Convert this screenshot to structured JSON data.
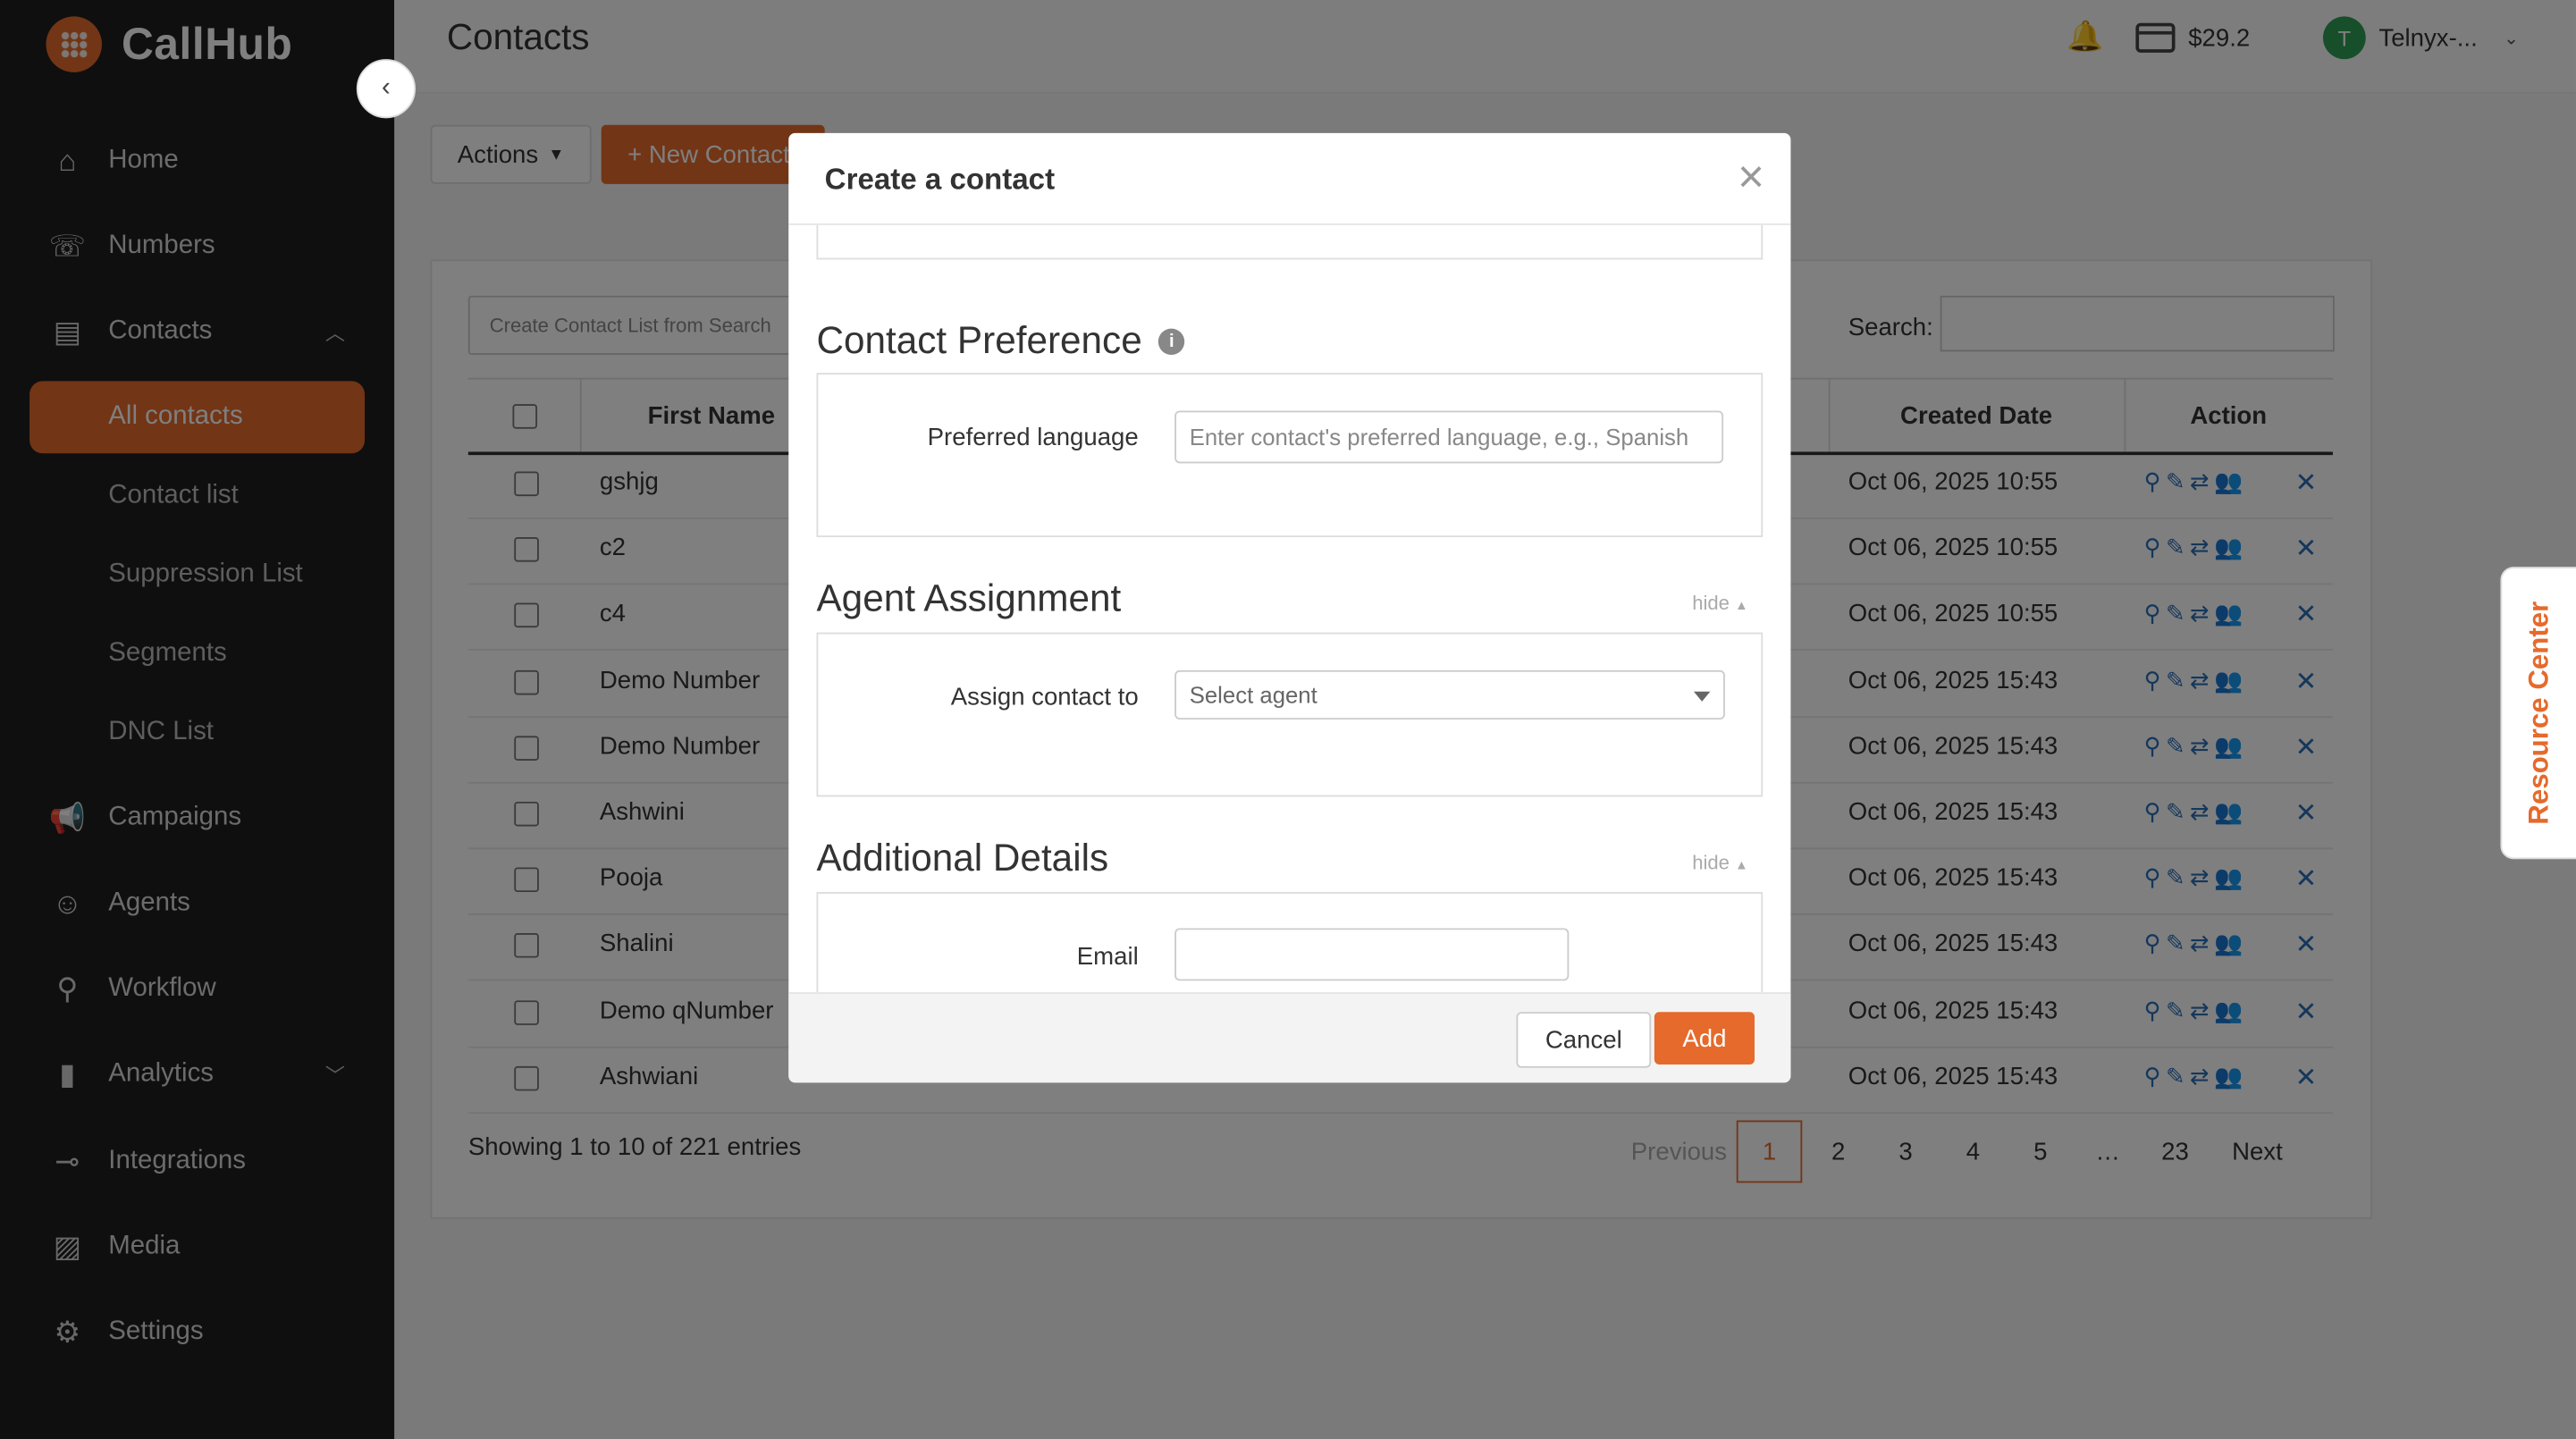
{
  "brand": {
    "name": "CallHub",
    "accent": "#e56a2c"
  },
  "sidebar": {
    "items": [
      {
        "label": "Home",
        "icon": "home-icon"
      },
      {
        "label": "Numbers",
        "icon": "phone-icon"
      },
      {
        "label": "Contacts",
        "icon": "contacts-book-icon"
      },
      {
        "label": "Campaigns",
        "icon": "megaphone-icon"
      },
      {
        "label": "Agents",
        "icon": "person-icon"
      },
      {
        "label": "Workflow",
        "icon": "workflow-icon"
      },
      {
        "label": "Analytics",
        "icon": "bar-chart-icon"
      },
      {
        "label": "Integrations",
        "icon": "plug-icon"
      },
      {
        "label": "Media",
        "icon": "image-icon"
      },
      {
        "label": "Settings",
        "icon": "gear-icon"
      }
    ],
    "contacts_sub": [
      "All contacts",
      "Contact list",
      "Suppression List",
      "Segments",
      "DNC List"
    ]
  },
  "header": {
    "title": "Contacts",
    "credit": "$29.2",
    "user_initial": "T",
    "user_name": "Telnyx-..."
  },
  "toolbar": {
    "actions_label": "Actions",
    "new_contact_label": "+ New Contact"
  },
  "table": {
    "list_placeholder": "Create Contact List from Search",
    "search_label": "Search:",
    "col_first_name": "First Name",
    "col_created_date": "Created Date",
    "col_action": "Action",
    "rows": [
      {
        "first_name": "gshjg",
        "created": "Oct 06, 2025 10:55"
      },
      {
        "first_name": "c2",
        "created": "Oct 06, 2025 10:55"
      },
      {
        "first_name": "c4",
        "created": "Oct 06, 2025 10:55"
      },
      {
        "first_name": "Demo Number",
        "created": "Oct 06, 2025 15:43"
      },
      {
        "first_name": "Demo Number",
        "created": "Oct 06, 2025 15:43"
      },
      {
        "first_name": "Ashwini",
        "created": "Oct 06, 2025 15:43"
      },
      {
        "first_name": "Pooja",
        "created": "Oct 06, 2025 15:43"
      },
      {
        "first_name": "Shalini",
        "created": "Oct 06, 2025 15:43"
      },
      {
        "first_name": "Demo qNumber",
        "created": "Oct 06, 2025 15:43"
      },
      {
        "first_name": "Ashwiani",
        "created": "Oct 06, 2025 15:43"
      }
    ],
    "info": "Showing 1 to 10 of 221 entries",
    "pager": {
      "prev": "Previous",
      "pages": [
        "1",
        "2",
        "3",
        "4",
        "5",
        "…",
        "23"
      ],
      "next": "Next"
    }
  },
  "resource_center": "Resource Center",
  "modal": {
    "title": "Create a contact",
    "close": "×",
    "contact_preference": {
      "title": "Contact Preference",
      "language_label": "Preferred language",
      "language_placeholder": "Enter contact's preferred language, e.g., Spanish"
    },
    "agent_assignment": {
      "title": "Agent Assignment",
      "hide": "hide",
      "assign_label": "Assign contact to",
      "assign_value": "Select agent"
    },
    "additional_details": {
      "title": "Additional Details",
      "hide": "hide",
      "email_label": "Email",
      "email_value": ""
    },
    "cancel": "Cancel",
    "add": "Add"
  }
}
